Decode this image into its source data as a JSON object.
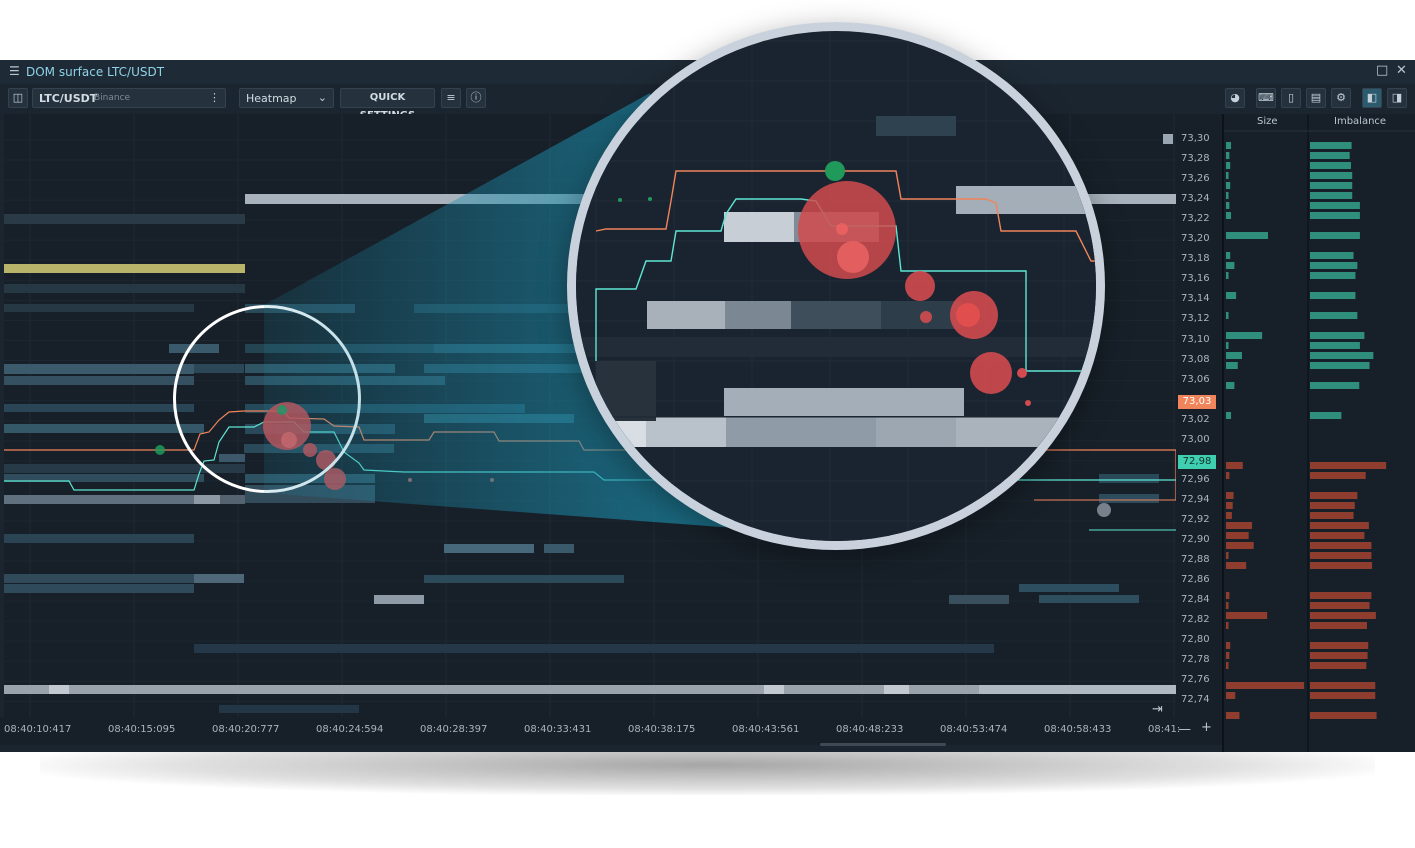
{
  "window": {
    "title": "DOM surface LTC/USDT"
  },
  "toolbar": {
    "symbol": "LTC/USDT",
    "exchange": "Binance",
    "visualization": "Heatmap",
    "quick_settings_label": "QUICK SETTINGS"
  },
  "icons": {
    "menu": "hamburger-icon",
    "sidebar": "sidebar-toggle-icon",
    "more": "more-vertical-icon",
    "dropdown": "chevron-down-icon",
    "sliders": "sliders-icon",
    "info": "info-icon",
    "keyboard": "keyboard-icon",
    "mouse": "mouse-icon",
    "template": "template-icon",
    "gear": "gear-icon",
    "panel_left": "panel-left-icon",
    "panel_right": "panel-right-icon",
    "maximize": "maximize-icon",
    "close": "close-icon",
    "scroll_end": "scroll-to-end-icon",
    "zoom_out": "minus-icon",
    "zoom_in": "plus-icon"
  },
  "colors": {
    "ask": "#f0845a",
    "bid": "#5ee6d2",
    "buy_bubble": "#1f9a5a",
    "sell_bubble": "#d24b4f",
    "size_bid_bar": "#2f8f7c",
    "size_ask_bar": "#8f3d2e"
  },
  "price_axis": {
    "levels": [
      "73,30",
      "73,28",
      "73,26",
      "73,24",
      "73,22",
      "73,20",
      "73,18",
      "73,16",
      "73,14",
      "73,12",
      "73,10",
      "73,08",
      "73,06",
      "73,03",
      "73,02",
      "73,00",
      "72,98",
      "72,96",
      "72,94",
      "72,92",
      "72,90",
      "72,88",
      "72,86",
      "72,84",
      "72,82",
      "72,80",
      "72,78",
      "72,76",
      "72,74"
    ],
    "best_ask": "73,03",
    "best_bid": "72,98"
  },
  "time_axis": {
    "labels": [
      "08:40:10:417",
      "08:40:15:095",
      "08:40:20:777",
      "08:40:24:594",
      "08:40:28:397",
      "08:40:33:431",
      "08:40:38:175",
      "08:40:43:561",
      "08:40:48:233",
      "08:40:53:474",
      "08:40:58:433",
      "08:41:"
    ]
  },
  "right_panel": {
    "size_header": "Size",
    "imbalance_header": "Imbalance",
    "bid_rows": [
      {
        "size": 0.06,
        "imbalance": 0.65
      },
      {
        "size": 0.04,
        "imbalance": 0.62
      },
      {
        "size": 0.05,
        "imbalance": 0.64
      },
      {
        "size": 0.03,
        "imbalance": 0.66
      },
      {
        "size": 0.05,
        "imbalance": 0.66
      },
      {
        "size": 0.03,
        "imbalance": 0.66
      },
      {
        "size": 0.04,
        "imbalance": 0.78
      },
      {
        "size": 0.06,
        "imbalance": 0.78
      },
      {
        "size": 0.5,
        "imbalance": 0.78
      },
      {
        "size": 0.05,
        "imbalance": 0.68
      },
      {
        "size": 0.1,
        "imbalance": 0.74
      },
      {
        "size": 0.03,
        "imbalance": 0.71
      },
      {
        "size": 0.12,
        "imbalance": 0.71
      },
      {
        "size": 0.03,
        "imbalance": 0.74
      },
      {
        "size": 0.43,
        "imbalance": 0.85
      },
      {
        "size": 0.03,
        "imbalance": 0.78
      },
      {
        "size": 0.19,
        "imbalance": 0.99
      },
      {
        "size": 0.14,
        "imbalance": 0.93
      },
      {
        "size": 0.1,
        "imbalance": 0.77
      },
      {
        "size": 0.06,
        "imbalance": 0.49
      }
    ],
    "ask_rows": [
      {
        "size": 0.2,
        "imbalance": 1.19
      },
      {
        "size": 0.04,
        "imbalance": 0.87
      },
      {
        "size": 0.09,
        "imbalance": 0.74
      },
      {
        "size": 0.08,
        "imbalance": 0.7
      },
      {
        "size": 0.07,
        "imbalance": 0.68
      },
      {
        "size": 0.31,
        "imbalance": 0.92
      },
      {
        "size": 0.27,
        "imbalance": 0.85
      },
      {
        "size": 0.33,
        "imbalance": 0.96
      },
      {
        "size": 0.03,
        "imbalance": 0.96
      },
      {
        "size": 0.24,
        "imbalance": 0.97
      },
      {
        "size": 0.04,
        "imbalance": 0.96
      },
      {
        "size": 0.03,
        "imbalance": 0.93
      },
      {
        "size": 0.49,
        "imbalance": 1.03
      },
      {
        "size": 0.03,
        "imbalance": 0.89
      },
      {
        "size": 0.05,
        "imbalance": 0.91
      },
      {
        "size": 0.04,
        "imbalance": 0.9
      },
      {
        "size": 0.03,
        "imbalance": 0.88
      },
      {
        "size": 0.93,
        "imbalance": 1.02
      },
      {
        "size": 0.11,
        "imbalance": 1.02
      },
      {
        "size": 0.16,
        "imbalance": 1.04
      }
    ]
  }
}
